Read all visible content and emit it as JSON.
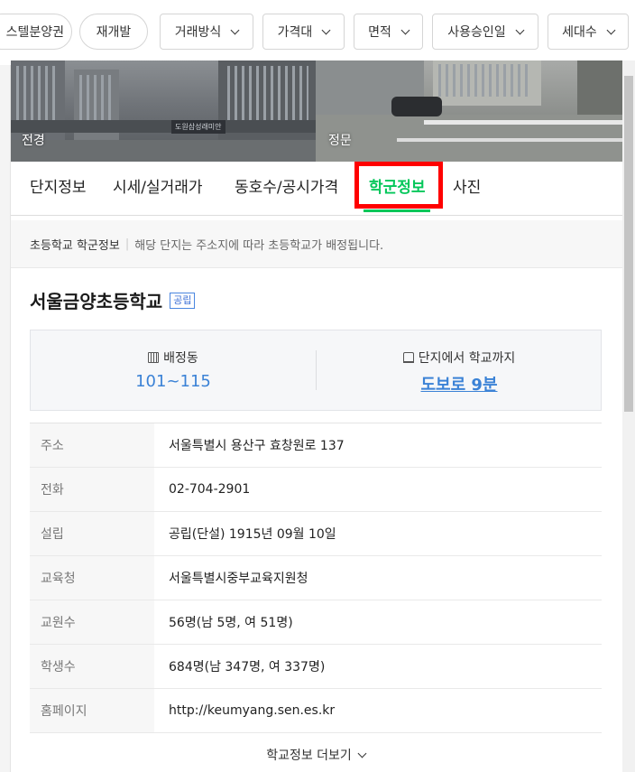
{
  "filters": {
    "chips": [
      {
        "label": "스텔분양권",
        "style": "round",
        "dropdown": false
      },
      {
        "label": "재개발",
        "style": "round",
        "dropdown": false
      },
      {
        "label": "거래방식",
        "style": "square",
        "dropdown": true
      },
      {
        "label": "가격대",
        "style": "square",
        "dropdown": true
      },
      {
        "label": "면적",
        "style": "square",
        "dropdown": true
      },
      {
        "label": "사용승인일",
        "style": "square",
        "dropdown": true
      },
      {
        "label": "세대수",
        "style": "square",
        "dropdown": true
      }
    ]
  },
  "photos": {
    "left_label": "전경",
    "left_sign": "도원삼성래미안",
    "right_label": "정문"
  },
  "tabs": [
    {
      "label": "단지정보",
      "active": false
    },
    {
      "label": "시세/실거래가",
      "active": false
    },
    {
      "label": "동호수/공시가격",
      "active": false
    },
    {
      "label": "학군정보",
      "active": true
    },
    {
      "label": "사진",
      "active": false
    }
  ],
  "notice": {
    "title": "초등학교 학군정보",
    "separator": "|",
    "description": "해당 단지는 주소지에 따라 초등학교가 배정됩니다."
  },
  "school": {
    "name": "서울금양초등학교",
    "badge": "공립",
    "assigned_label": "배정동",
    "assigned_value": "101~115",
    "distance_label": "단지에서 학교까지",
    "distance_value": "도보로 9분"
  },
  "details": [
    {
      "key": "주소",
      "value": "서울특별시 용산구 효창원로 137"
    },
    {
      "key": "전화",
      "value": "02-704-2901"
    },
    {
      "key": "설립",
      "value": "공립(단설) 1915년 09월 10일"
    },
    {
      "key": "교육청",
      "value": "서울특별시중부교육지원청"
    },
    {
      "key": "교원수",
      "value": "56명(남 5명, 여 51명)"
    },
    {
      "key": "학생수",
      "value": "684명(남 347명, 여 337명)"
    },
    {
      "key": "홈페이지",
      "value": "http://keumyang.sen.es.kr"
    }
  ],
  "more_label": "학교정보 더보기",
  "colors": {
    "accent": "#03c75a",
    "link": "#3b82d6",
    "highlight": "#ff0000"
  }
}
